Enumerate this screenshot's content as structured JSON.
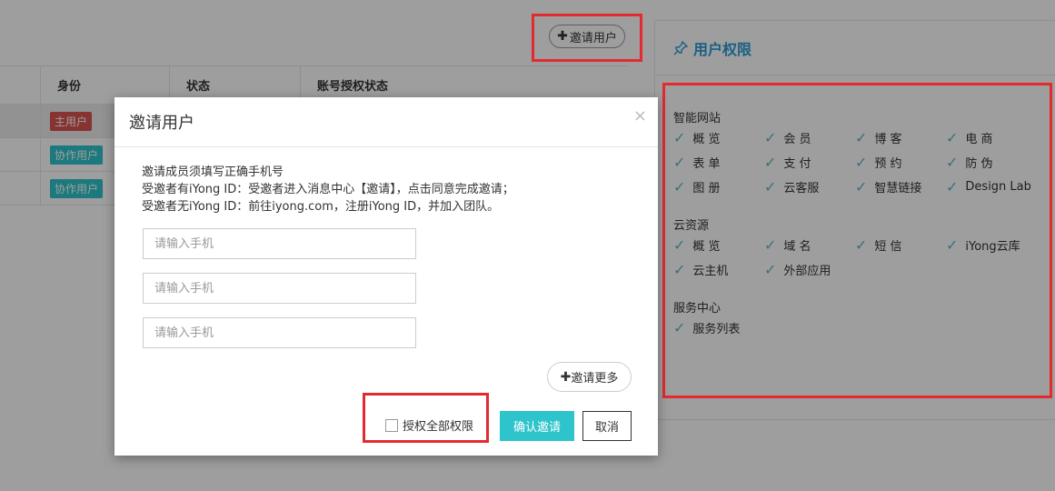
{
  "toolbar": {
    "invite_label": "邀请用户"
  },
  "table": {
    "headers": [
      "身份",
      "状态",
      "账号授权状态"
    ],
    "rows": [
      {
        "role": "主用户",
        "role_color": "#d9534f"
      },
      {
        "role": "协作用户",
        "role_color": "#2ec4cb"
      },
      {
        "role": "协作用户",
        "role_color": "#2ec4cb"
      }
    ]
  },
  "permissions": {
    "title": "用户权限",
    "groups": [
      {
        "name": "智能网站",
        "items": [
          "概 览",
          "会 员",
          "博 客",
          "电 商",
          "表 单",
          "支 付",
          "预 约",
          "防 伪",
          "图 册",
          "云客服",
          "智慧链接",
          "Design Lab"
        ]
      },
      {
        "name": "云资源",
        "items": [
          "概 览",
          "域 名",
          "短 信",
          "iYong云库",
          "云主机",
          "外部应用"
        ]
      },
      {
        "name": "服务中心",
        "items": [
          "服务列表"
        ]
      }
    ]
  },
  "modal": {
    "title": "邀请用户",
    "close": "×",
    "notice": [
      "邀请成员须填写正确手机号",
      "受邀者有iYong ID：受邀者进入消息中心【邀请】，点击同意完成邀请；",
      "受邀者无iYong ID：前往iyong.com，注册iYong ID，并加入团队。"
    ],
    "phone_placeholder": "请输入手机",
    "phone_inputs": [
      "",
      "",
      ""
    ],
    "invite_more": "邀请更多",
    "grant_all": "授权全部权限",
    "grant_all_checked": false,
    "confirm": "确认邀请",
    "cancel": "取消"
  },
  "colors": {
    "accent": "#2ec4cb",
    "highlight": "#e32a2f",
    "title_blue": "#2a9bd6"
  },
  "icons": {
    "plus": "plus-icon",
    "pin": "pin-icon",
    "check": "check-icon",
    "close": "close-icon"
  }
}
